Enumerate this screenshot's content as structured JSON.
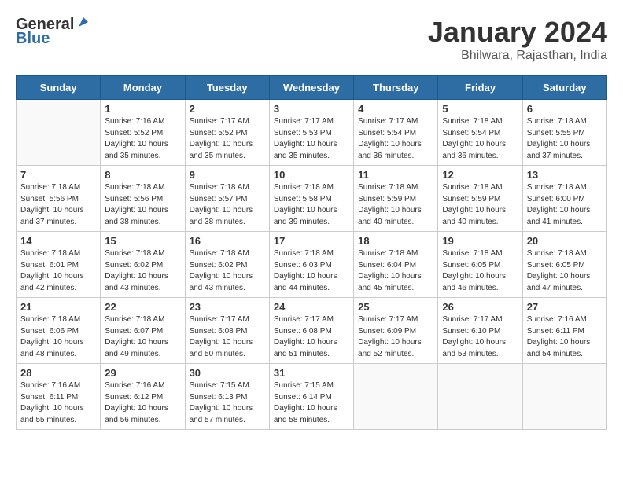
{
  "header": {
    "logo_line1": "General",
    "logo_line2": "Blue",
    "month": "January 2024",
    "location": "Bhilwara, Rajasthan, India"
  },
  "weekdays": [
    "Sunday",
    "Monday",
    "Tuesday",
    "Wednesday",
    "Thursday",
    "Friday",
    "Saturday"
  ],
  "weeks": [
    [
      {
        "day": "",
        "sunrise": "",
        "sunset": "",
        "daylight": ""
      },
      {
        "day": "1",
        "sunrise": "7:16 AM",
        "sunset": "5:52 PM",
        "daylight": "10 hours and 35 minutes."
      },
      {
        "day": "2",
        "sunrise": "7:17 AM",
        "sunset": "5:52 PM",
        "daylight": "10 hours and 35 minutes."
      },
      {
        "day": "3",
        "sunrise": "7:17 AM",
        "sunset": "5:53 PM",
        "daylight": "10 hours and 35 minutes."
      },
      {
        "day": "4",
        "sunrise": "7:17 AM",
        "sunset": "5:54 PM",
        "daylight": "10 hours and 36 minutes."
      },
      {
        "day": "5",
        "sunrise": "7:18 AM",
        "sunset": "5:54 PM",
        "daylight": "10 hours and 36 minutes."
      },
      {
        "day": "6",
        "sunrise": "7:18 AM",
        "sunset": "5:55 PM",
        "daylight": "10 hours and 37 minutes."
      }
    ],
    [
      {
        "day": "7",
        "sunrise": "7:18 AM",
        "sunset": "5:56 PM",
        "daylight": "10 hours and 37 minutes."
      },
      {
        "day": "8",
        "sunrise": "7:18 AM",
        "sunset": "5:56 PM",
        "daylight": "10 hours and 38 minutes."
      },
      {
        "day": "9",
        "sunrise": "7:18 AM",
        "sunset": "5:57 PM",
        "daylight": "10 hours and 38 minutes."
      },
      {
        "day": "10",
        "sunrise": "7:18 AM",
        "sunset": "5:58 PM",
        "daylight": "10 hours and 39 minutes."
      },
      {
        "day": "11",
        "sunrise": "7:18 AM",
        "sunset": "5:59 PM",
        "daylight": "10 hours and 40 minutes."
      },
      {
        "day": "12",
        "sunrise": "7:18 AM",
        "sunset": "5:59 PM",
        "daylight": "10 hours and 40 minutes."
      },
      {
        "day": "13",
        "sunrise": "7:18 AM",
        "sunset": "6:00 PM",
        "daylight": "10 hours and 41 minutes."
      }
    ],
    [
      {
        "day": "14",
        "sunrise": "7:18 AM",
        "sunset": "6:01 PM",
        "daylight": "10 hours and 42 minutes."
      },
      {
        "day": "15",
        "sunrise": "7:18 AM",
        "sunset": "6:02 PM",
        "daylight": "10 hours and 43 minutes."
      },
      {
        "day": "16",
        "sunrise": "7:18 AM",
        "sunset": "6:02 PM",
        "daylight": "10 hours and 43 minutes."
      },
      {
        "day": "17",
        "sunrise": "7:18 AM",
        "sunset": "6:03 PM",
        "daylight": "10 hours and 44 minutes."
      },
      {
        "day": "18",
        "sunrise": "7:18 AM",
        "sunset": "6:04 PM",
        "daylight": "10 hours and 45 minutes."
      },
      {
        "day": "19",
        "sunrise": "7:18 AM",
        "sunset": "6:05 PM",
        "daylight": "10 hours and 46 minutes."
      },
      {
        "day": "20",
        "sunrise": "7:18 AM",
        "sunset": "6:05 PM",
        "daylight": "10 hours and 47 minutes."
      }
    ],
    [
      {
        "day": "21",
        "sunrise": "7:18 AM",
        "sunset": "6:06 PM",
        "daylight": "10 hours and 48 minutes."
      },
      {
        "day": "22",
        "sunrise": "7:18 AM",
        "sunset": "6:07 PM",
        "daylight": "10 hours and 49 minutes."
      },
      {
        "day": "23",
        "sunrise": "7:17 AM",
        "sunset": "6:08 PM",
        "daylight": "10 hours and 50 minutes."
      },
      {
        "day": "24",
        "sunrise": "7:17 AM",
        "sunset": "6:08 PM",
        "daylight": "10 hours and 51 minutes."
      },
      {
        "day": "25",
        "sunrise": "7:17 AM",
        "sunset": "6:09 PM",
        "daylight": "10 hours and 52 minutes."
      },
      {
        "day": "26",
        "sunrise": "7:17 AM",
        "sunset": "6:10 PM",
        "daylight": "10 hours and 53 minutes."
      },
      {
        "day": "27",
        "sunrise": "7:16 AM",
        "sunset": "6:11 PM",
        "daylight": "10 hours and 54 minutes."
      }
    ],
    [
      {
        "day": "28",
        "sunrise": "7:16 AM",
        "sunset": "6:11 PM",
        "daylight": "10 hours and 55 minutes."
      },
      {
        "day": "29",
        "sunrise": "7:16 AM",
        "sunset": "6:12 PM",
        "daylight": "10 hours and 56 minutes."
      },
      {
        "day": "30",
        "sunrise": "7:15 AM",
        "sunset": "6:13 PM",
        "daylight": "10 hours and 57 minutes."
      },
      {
        "day": "31",
        "sunrise": "7:15 AM",
        "sunset": "6:14 PM",
        "daylight": "10 hours and 58 minutes."
      },
      {
        "day": "",
        "sunrise": "",
        "sunset": "",
        "daylight": ""
      },
      {
        "day": "",
        "sunrise": "",
        "sunset": "",
        "daylight": ""
      },
      {
        "day": "",
        "sunrise": "",
        "sunset": "",
        "daylight": ""
      }
    ]
  ]
}
